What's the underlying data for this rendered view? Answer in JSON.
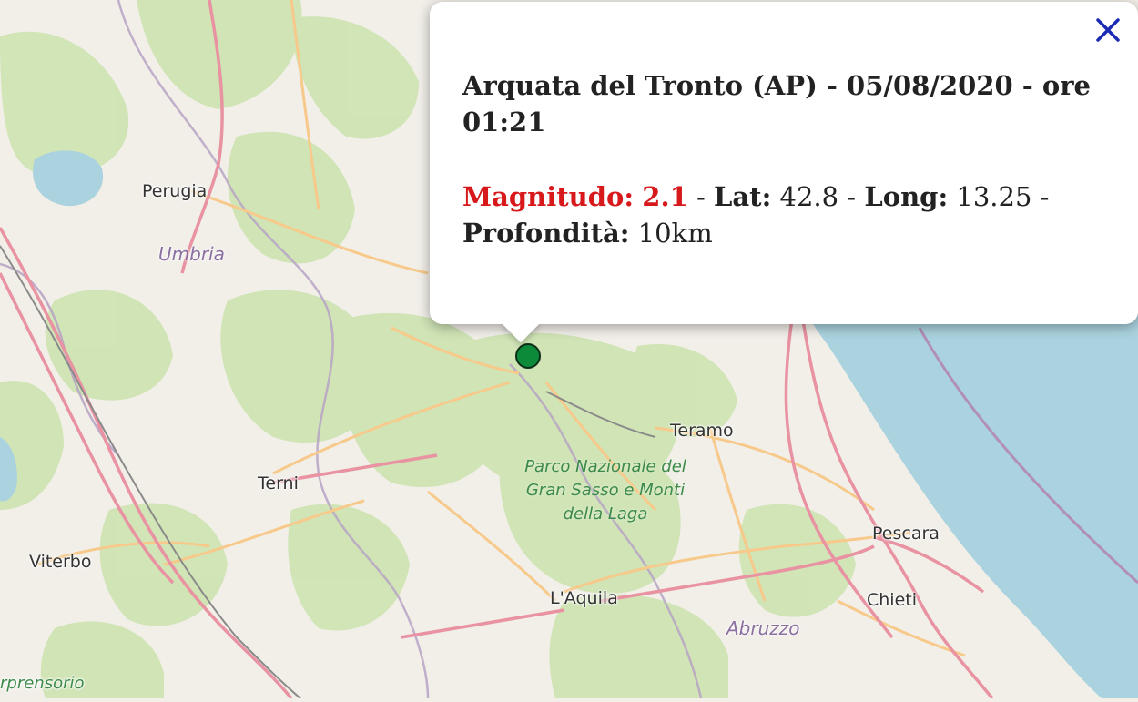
{
  "map": {
    "colors": {
      "land": "#f2efe9",
      "forest": "#cfe4b4",
      "sea": "#aad3df",
      "major_road": "#e892a2",
      "secondary_road": "#f7c98a",
      "border": "#9e8ab0"
    },
    "cities": [
      {
        "id": "perugia",
        "name": "Perugia"
      },
      {
        "id": "terni",
        "name": "Terni"
      },
      {
        "id": "viterbo",
        "name": "Viterbo"
      },
      {
        "id": "teramo",
        "name": "Teramo"
      },
      {
        "id": "pescara",
        "name": "Pescara"
      },
      {
        "id": "chieti",
        "name": "Chieti"
      },
      {
        "id": "laquila",
        "name": "L'Aquila"
      }
    ],
    "regions": [
      {
        "id": "umbria",
        "name": "Umbria"
      },
      {
        "id": "abruzzo",
        "name": "Abruzzo"
      }
    ],
    "park_label": "Parco Nazionale del Gran Sasso e Monti della Laga",
    "partial_label": "rprensorio",
    "marker": {
      "color": "#0c8a3a",
      "icon": "earthquake-location-marker"
    }
  },
  "popup": {
    "close_icon": "✕",
    "title": "Arquata del Tronto (AP) - 05/08/2020 - ore 01:21",
    "magnitude_label": "Magnitudo:",
    "magnitude_value": "2.1",
    "lat_label": "Lat:",
    "lat_value": "42.8",
    "long_label": "Long:",
    "long_value": "13.25",
    "depth_label": "Profondità:",
    "depth_value": "10km",
    "separator": " - ",
    "magnitude_color": "#d7191c"
  }
}
